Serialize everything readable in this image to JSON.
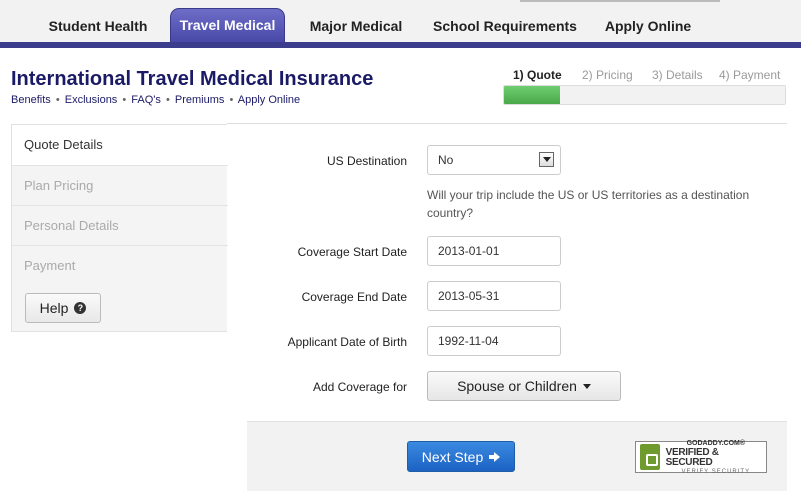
{
  "nav": {
    "tabs": [
      {
        "label": "Student Health"
      },
      {
        "label": "Travel Medical",
        "active": true
      },
      {
        "label": "Major Medical"
      },
      {
        "label": "School Requirements"
      },
      {
        "label": "Apply Online"
      }
    ]
  },
  "header": {
    "title": "International Travel Medical Insurance",
    "links": [
      "Benefits",
      "Exclusions",
      "FAQ's",
      "Premiums",
      "Apply Online"
    ],
    "separator": "•"
  },
  "steps": {
    "items": [
      "1) Quote",
      "2) Pricing",
      "3) Details",
      "4) Payment"
    ],
    "current": 1,
    "progress_fraction": 0.2
  },
  "sidebar": {
    "items": [
      {
        "label": "Quote Details",
        "active": true
      },
      {
        "label": "Plan Pricing"
      },
      {
        "label": "Personal Details"
      },
      {
        "label": "Payment"
      }
    ],
    "help_label": "Help",
    "help_icon": "question-circle-icon"
  },
  "form": {
    "us_destination": {
      "label": "US Destination",
      "value": "No",
      "hint": "Will your trip include the US or US territories as a destination country?"
    },
    "start_date": {
      "label": "Coverage Start Date",
      "value": "2013-01-01"
    },
    "end_date": {
      "label": "Coverage End Date",
      "value": "2013-05-31"
    },
    "dob": {
      "label": "Applicant Date of Birth",
      "value": "1992-11-04"
    },
    "add_coverage": {
      "label": "Add Coverage for",
      "button": "Spouse or Children"
    }
  },
  "footer": {
    "next_label": "Next Step",
    "seal": {
      "line1": "GODADDY.COM®",
      "line2": "VERIFIED & SECURED",
      "line3": "VERIFY SECURITY"
    }
  },
  "colors": {
    "nav_accent": "#3c3c8c",
    "title": "#1a1a66",
    "progress": "#4aa84a",
    "primary_button": "#1c62c4"
  }
}
